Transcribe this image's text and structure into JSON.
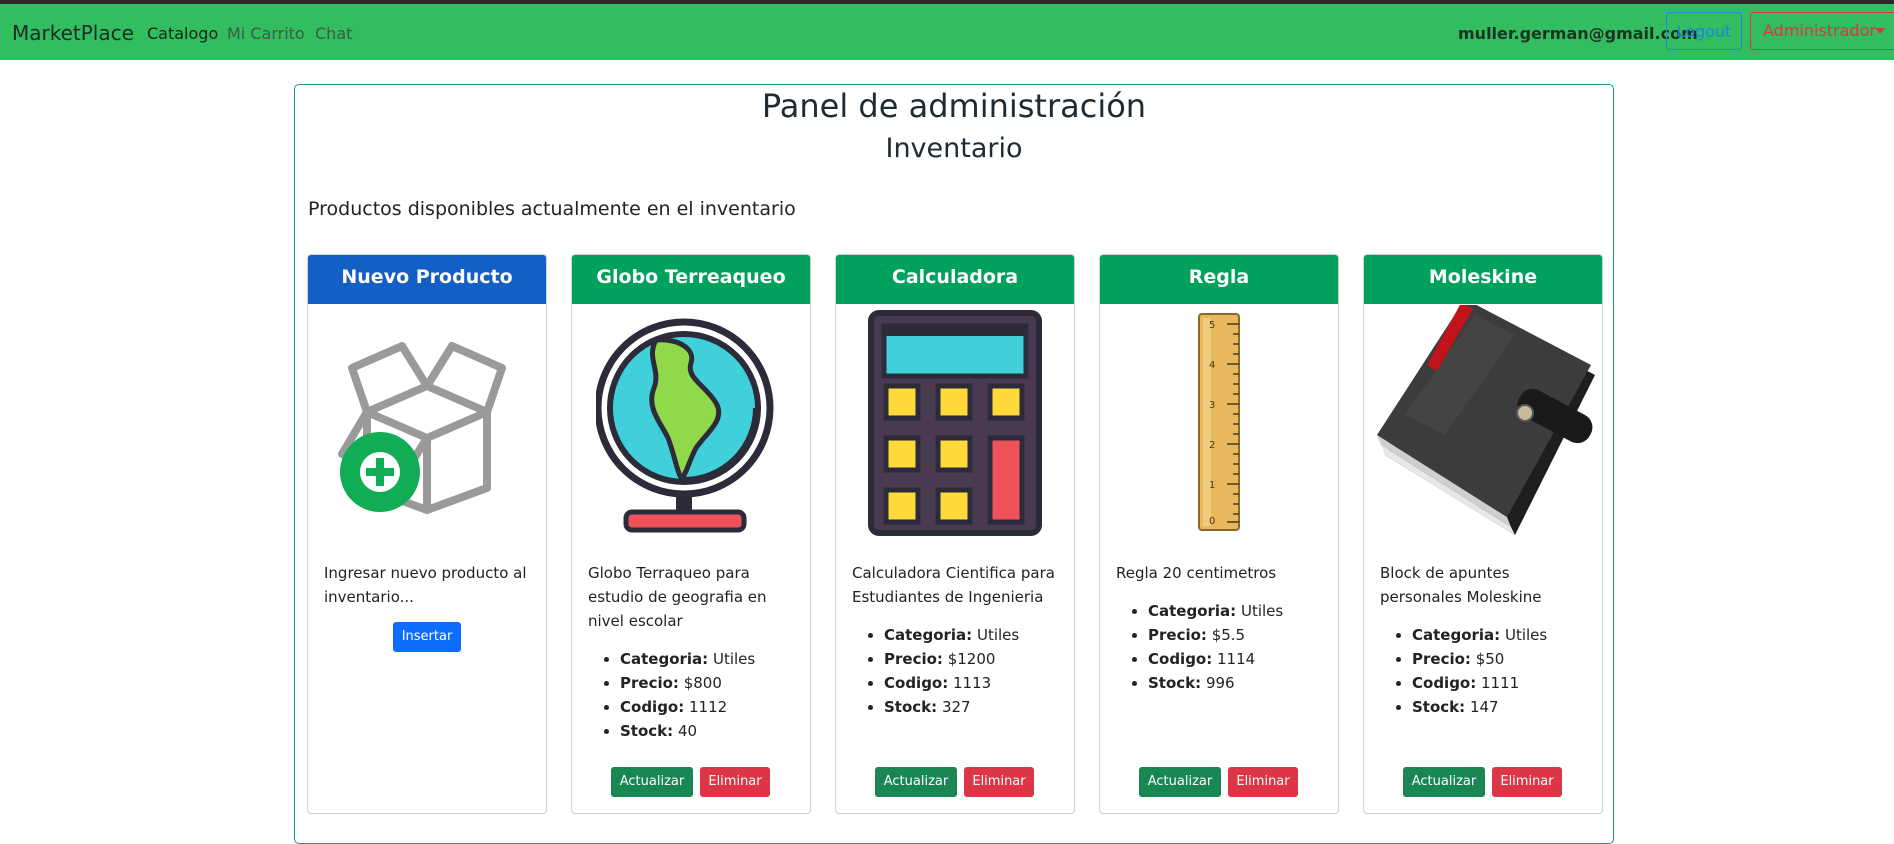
{
  "navbar": {
    "brand": "MarketPlace",
    "links": [
      "Catalogo",
      "Mi Carrito",
      "Chat"
    ],
    "user_email": "muller.german@gmail.com",
    "logout_label": "Logout",
    "admin_label": "Administrador",
    "bg_color": "#31bd60"
  },
  "panel": {
    "title": "Panel de administración",
    "subtitle": "Inventario",
    "description": "Productos disponibles actualmente en el inventario"
  },
  "new_product": {
    "title": "Nuevo Producto",
    "text": "Ingresar nuevo producto al inventario...",
    "button": "Insertar",
    "icon": "add-box-icon"
  },
  "labels": {
    "category": "Categoria:",
    "price": "Precio:",
    "code": "Codigo:",
    "stock": "Stock:",
    "update": "Actualizar",
    "delete": "Eliminar"
  },
  "products": [
    {
      "title": "Globo Terreaqueo",
      "description": "Globo Terraqueo para estudio de geografia en nivel escolar",
      "category": "Utiles",
      "price": "$800",
      "code": "1112",
      "stock": "40",
      "icon": "globe-icon"
    },
    {
      "title": "Calculadora",
      "description": "Calculadora Cientifica para Estudiantes de Ingenieria",
      "category": "Utiles",
      "price": "$1200",
      "code": "1113",
      "stock": "327",
      "icon": "calculator-icon"
    },
    {
      "title": "Regla",
      "description": "Regla 20 centimetros",
      "category": "Utiles",
      "price": "$5.5",
      "code": "1114",
      "stock": "996",
      "icon": "ruler-icon"
    },
    {
      "title": "Moleskine",
      "description": "Block de apuntes personales Moleskine",
      "category": "Utiles",
      "price": "$50",
      "code": "1111",
      "stock": "147",
      "icon": "notebook-icon"
    }
  ],
  "colors": {
    "new_header": "#145fc5",
    "product_header": "#00a15c",
    "update": "#198754",
    "delete": "#dc3545",
    "insert": "#0d6efd"
  }
}
